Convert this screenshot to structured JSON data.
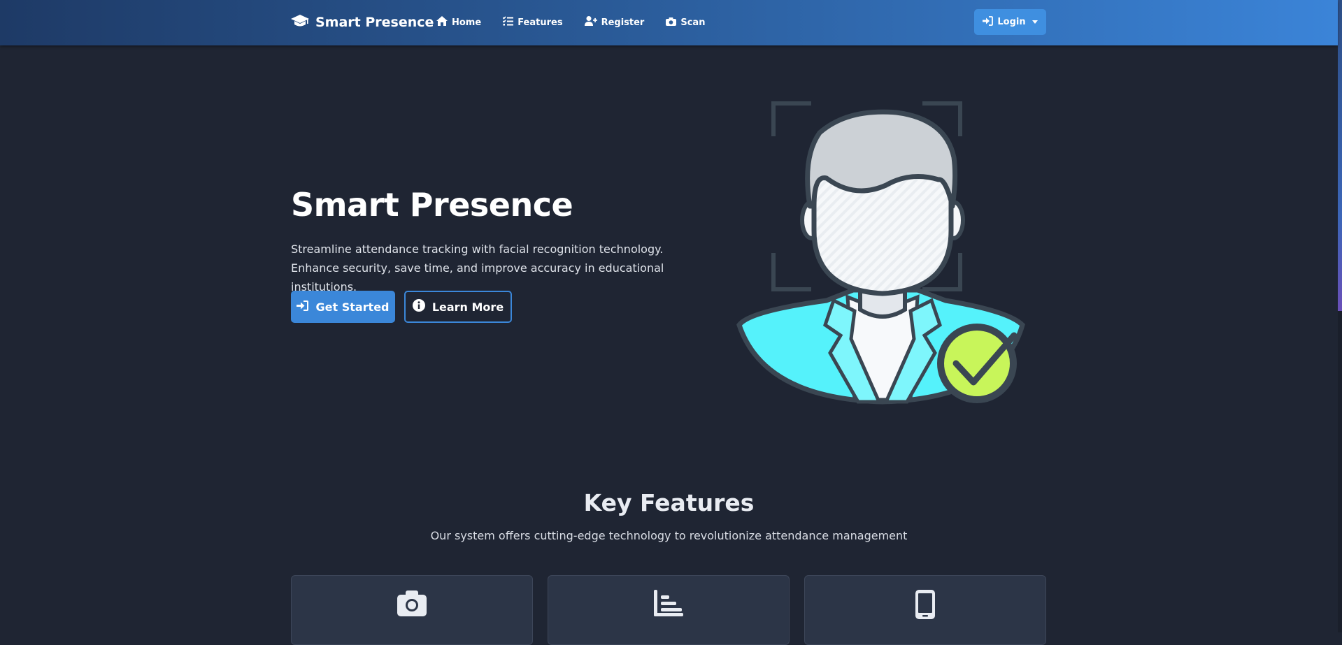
{
  "nav": {
    "brand": "Smart Presence",
    "links": [
      {
        "label": "Home",
        "icon": "home-icon"
      },
      {
        "label": "Features",
        "icon": "list-check-icon"
      },
      {
        "label": "Register",
        "icon": "user-plus-icon"
      },
      {
        "label": "Scan",
        "icon": "camera-icon"
      }
    ],
    "login_label": "Login"
  },
  "hero": {
    "title": "Smart Presence",
    "description": "Streamline attendance tracking with facial recognition technology. Enhance security, save time, and improve accuracy in educational institutions.",
    "primary_button": "Get Started",
    "secondary_button": "Learn More",
    "illustration": "face-recognition-verified-illustration"
  },
  "features": {
    "title": "Key Features",
    "subtitle": "Our system offers cutting-edge technology to revolutionize attendance management",
    "cards": [
      {
        "icon": "camera-icon"
      },
      {
        "icon": "bar-chart-icon"
      },
      {
        "icon": "mobile-phone-icon"
      }
    ]
  },
  "colors": {
    "nav_gradient_start": "#1e3a66",
    "nav_gradient_end": "#3b84d8",
    "accent": "#3b87d9",
    "background": "#1f2533",
    "card": "#2c3547",
    "check": "#c8f55a"
  }
}
